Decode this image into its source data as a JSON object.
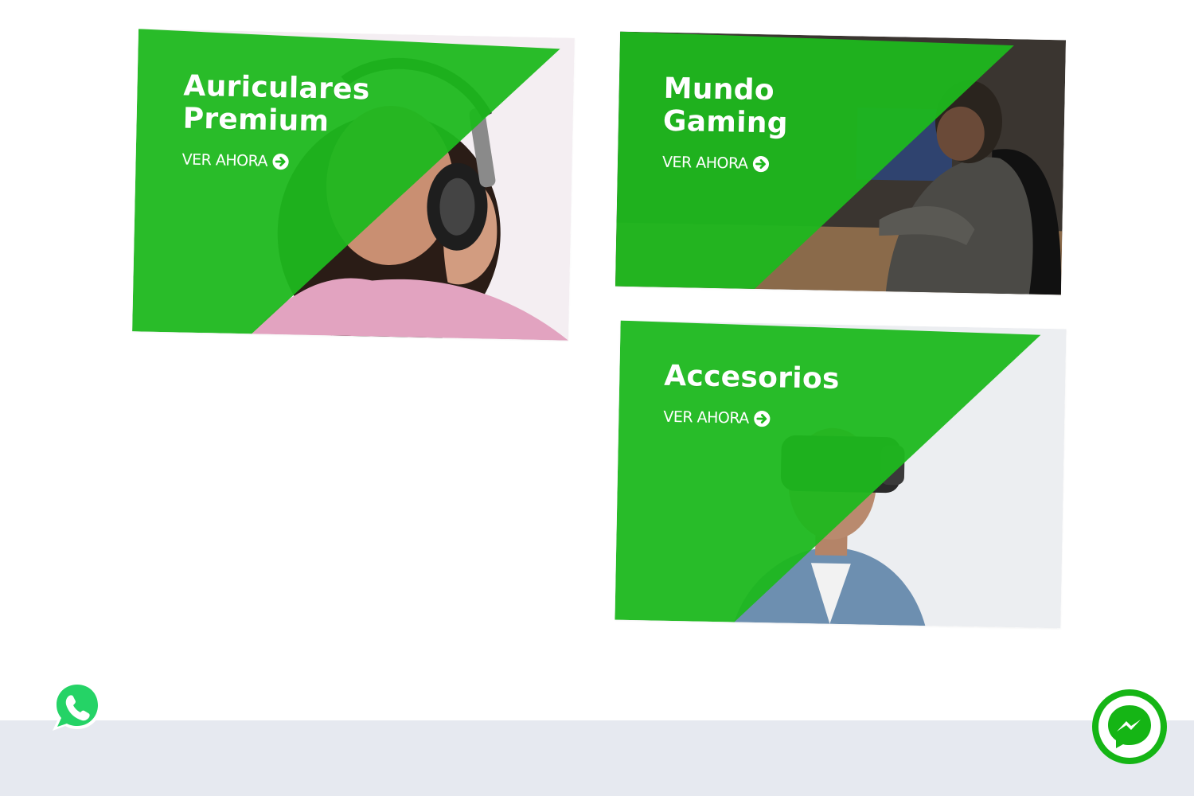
{
  "theme": {
    "accent": "#1db81d",
    "footer_band": "#e6e9f0",
    "whatsapp": "#25d366",
    "messenger_ring": "#15b515"
  },
  "banners": [
    {
      "title_line1": "Auriculares",
      "title_line2": "Premium",
      "cta": "VER AHORA",
      "icon": "arrow-right-circle-icon"
    },
    {
      "title_line1": "Mundo",
      "title_line2": "Gaming",
      "cta": "VER AHORA",
      "icon": "arrow-right-circle-icon"
    },
    {
      "title_line1": "Accesorios",
      "title_line2": "",
      "cta": "VER AHORA",
      "icon": "arrow-right-circle-icon"
    }
  ],
  "floating": {
    "whatsapp_icon": "whatsapp-icon",
    "messenger_icon": "messenger-icon"
  }
}
